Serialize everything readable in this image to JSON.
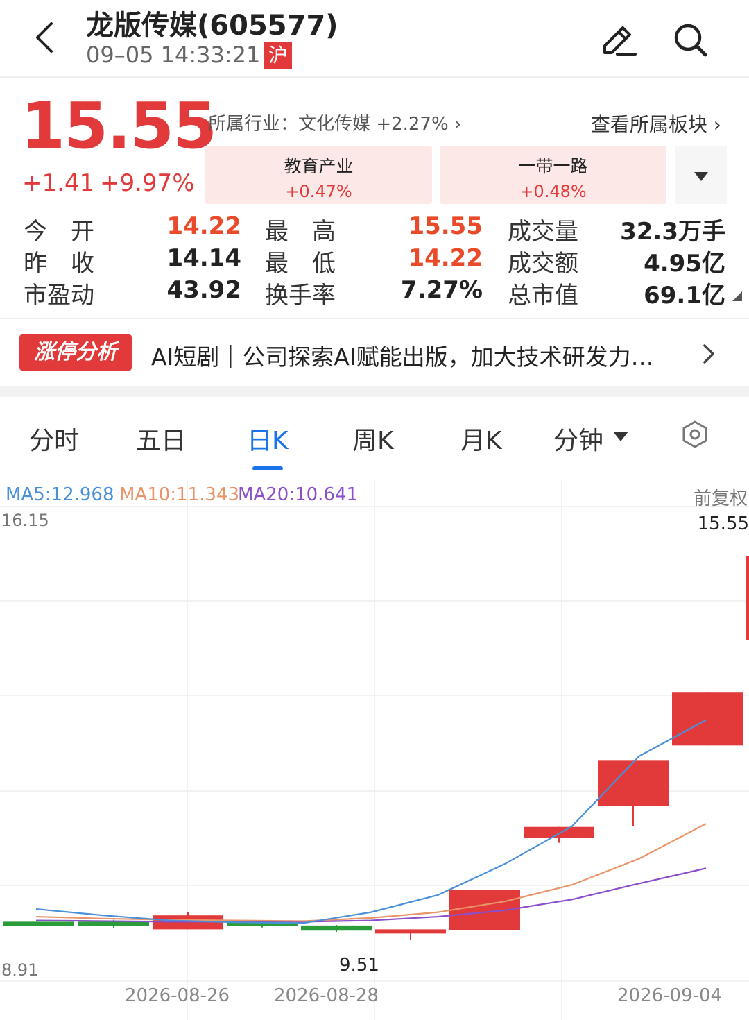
{
  "header": {
    "title": "龙版传媒(605577)",
    "datetime": "09–05 14:33:21",
    "market_badge": "沪",
    "icons": [
      "back-arrow-icon",
      "edit-icon",
      "search-icon"
    ]
  },
  "quote": {
    "price": "15.55",
    "change": "+1.41",
    "change_pct": "+9.97%",
    "industry_text": "所属行业：文化传媒 +2.27% ›",
    "sector_link": "查看所属板块 ›",
    "concepts": [
      {
        "name": "教育产业",
        "pct": "+0.47%"
      },
      {
        "name": "一带一路",
        "pct": "+0.48%"
      }
    ],
    "stats": [
      {
        "label": "今　开",
        "value": "14.22"
      },
      {
        "label": "最　高",
        "value": "15.55"
      },
      {
        "label": "成交量",
        "value": "32.3万手"
      },
      {
        "label": "昨　收",
        "value": "14.14"
      },
      {
        "label": "最　低",
        "value": "14.22"
      },
      {
        "label": "成交额",
        "value": "4.95亿"
      },
      {
        "label": "市盈动",
        "value": "43.92"
      },
      {
        "label": "换手率",
        "value": "7.27%"
      },
      {
        "label": "总市值",
        "value": "69.1亿"
      }
    ]
  },
  "news": {
    "badge": "涨停分析",
    "text": "AI短剧｜公司探索AI赋能出版，加大技术研发力…"
  },
  "tabs": [
    "分时",
    "五日",
    "日K",
    "周K",
    "月K",
    "分钟"
  ],
  "active_tab": "日K",
  "colors": {
    "up": "#e23a3a",
    "down": "#2a9d3a",
    "accent": "#1a73e8",
    "ma5": "#4a90d9",
    "ma10": "#e8956a",
    "ma20": "#8a4fc9"
  },
  "chart_data": {
    "type": "candlestick",
    "ma_labels": {
      "ma5": "MA5:12.968",
      "ma10": "MA10:11.343",
      "ma20": "MA20:10.641"
    },
    "adjust_label": "前复权",
    "y_top": "16.15",
    "y_bottom": "8.91",
    "ylim": [
      8.91,
      16.15
    ],
    "x_labels": [
      "2026-08-26",
      "2026-08-28",
      "2026-09-04"
    ],
    "max_label": "15.55",
    "min_label": "9.51",
    "candles": [
      {
        "open": 9.8,
        "close": 9.76,
        "high": 9.8,
        "low": 9.76
      },
      {
        "open": 9.8,
        "close": 9.76,
        "high": 9.83,
        "low": 9.7
      },
      {
        "open": 9.68,
        "close": 9.9,
        "high": 9.95,
        "low": 9.68
      },
      {
        "open": 9.81,
        "close": 9.73,
        "high": 9.81,
        "low": 9.71
      },
      {
        "open": 9.74,
        "close": 9.66,
        "high": 9.75,
        "low": 9.64
      },
      {
        "open": 9.64,
        "close": 9.68,
        "high": 9.68,
        "low": 9.51
      },
      {
        "open": 9.67,
        "close": 10.3,
        "high": 10.3,
        "low": 9.67
      },
      {
        "open": 11.12,
        "close": 11.29,
        "high": 11.29,
        "low": 11.04
      },
      {
        "open": 11.62,
        "close": 12.33,
        "high": 12.33,
        "low": 11.3
      },
      {
        "open": 12.57,
        "close": 13.4,
        "high": 13.4,
        "low": 12.57
      },
      {
        "open": 14.22,
        "close": 15.55,
        "high": 15.55,
        "low": 14.22
      }
    ],
    "ma5": [
      null,
      10.0,
      9.9,
      9.82,
      9.79,
      9.78,
      9.95,
      10.22,
      10.71,
      11.3,
      12.4,
      12.97
    ],
    "ma10": [
      null,
      9.88,
      9.85,
      9.83,
      9.82,
      9.81,
      9.86,
      9.95,
      10.12,
      10.38,
      10.79,
      11.34
    ],
    "ma20": [
      null,
      9.82,
      9.81,
      9.8,
      9.8,
      9.8,
      9.82,
      9.88,
      9.98,
      10.15,
      10.4,
      10.64
    ]
  }
}
